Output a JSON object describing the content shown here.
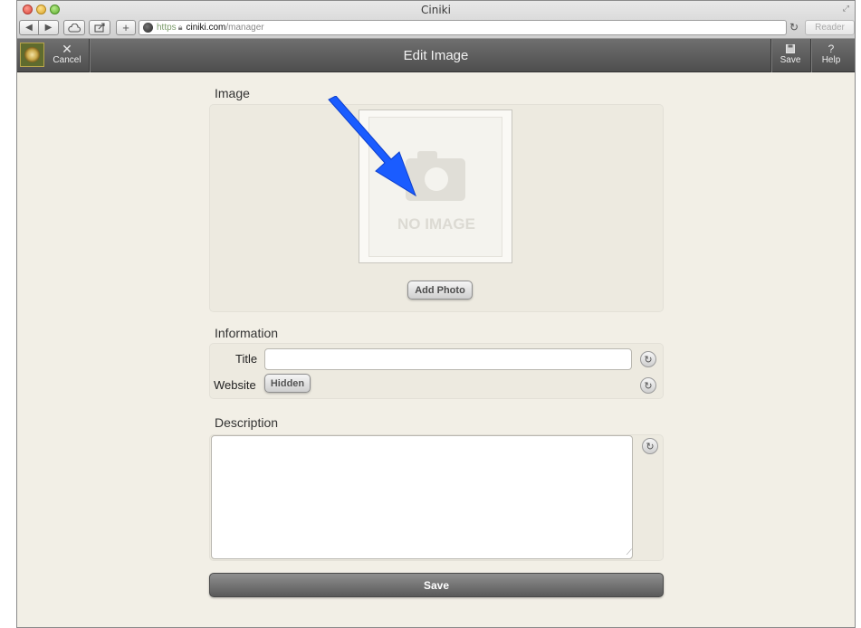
{
  "browser": {
    "window_title": "Ciniki",
    "url_scheme": "https",
    "url_host": "ciniki.com",
    "url_path": "/manager",
    "reader_label": "Reader",
    "icons": {
      "back": "back-arrow-icon",
      "forward": "forward-arrow-icon",
      "cloud": "icloud-icon",
      "share": "share-icon",
      "add": "plus-icon",
      "reload": "reload-icon"
    }
  },
  "app_header": {
    "title": "Edit Image",
    "cancel_label": "Cancel",
    "save_label": "Save",
    "help_label": "Help",
    "help_glyph": "?"
  },
  "image_section": {
    "title": "Image",
    "placeholder_text": "NO IMAGE",
    "add_photo_label": "Add Photo"
  },
  "information_section": {
    "title": "Information",
    "title_label": "Title",
    "title_value": "",
    "website_label": "Website",
    "website_button_label": "Hidden"
  },
  "description_section": {
    "title": "Description",
    "value": ""
  },
  "save_button_label": "Save",
  "colors": {
    "header_bg": "#5e5e5e",
    "page_bg": "#f2efe6",
    "arrow": "#1a5cff"
  }
}
